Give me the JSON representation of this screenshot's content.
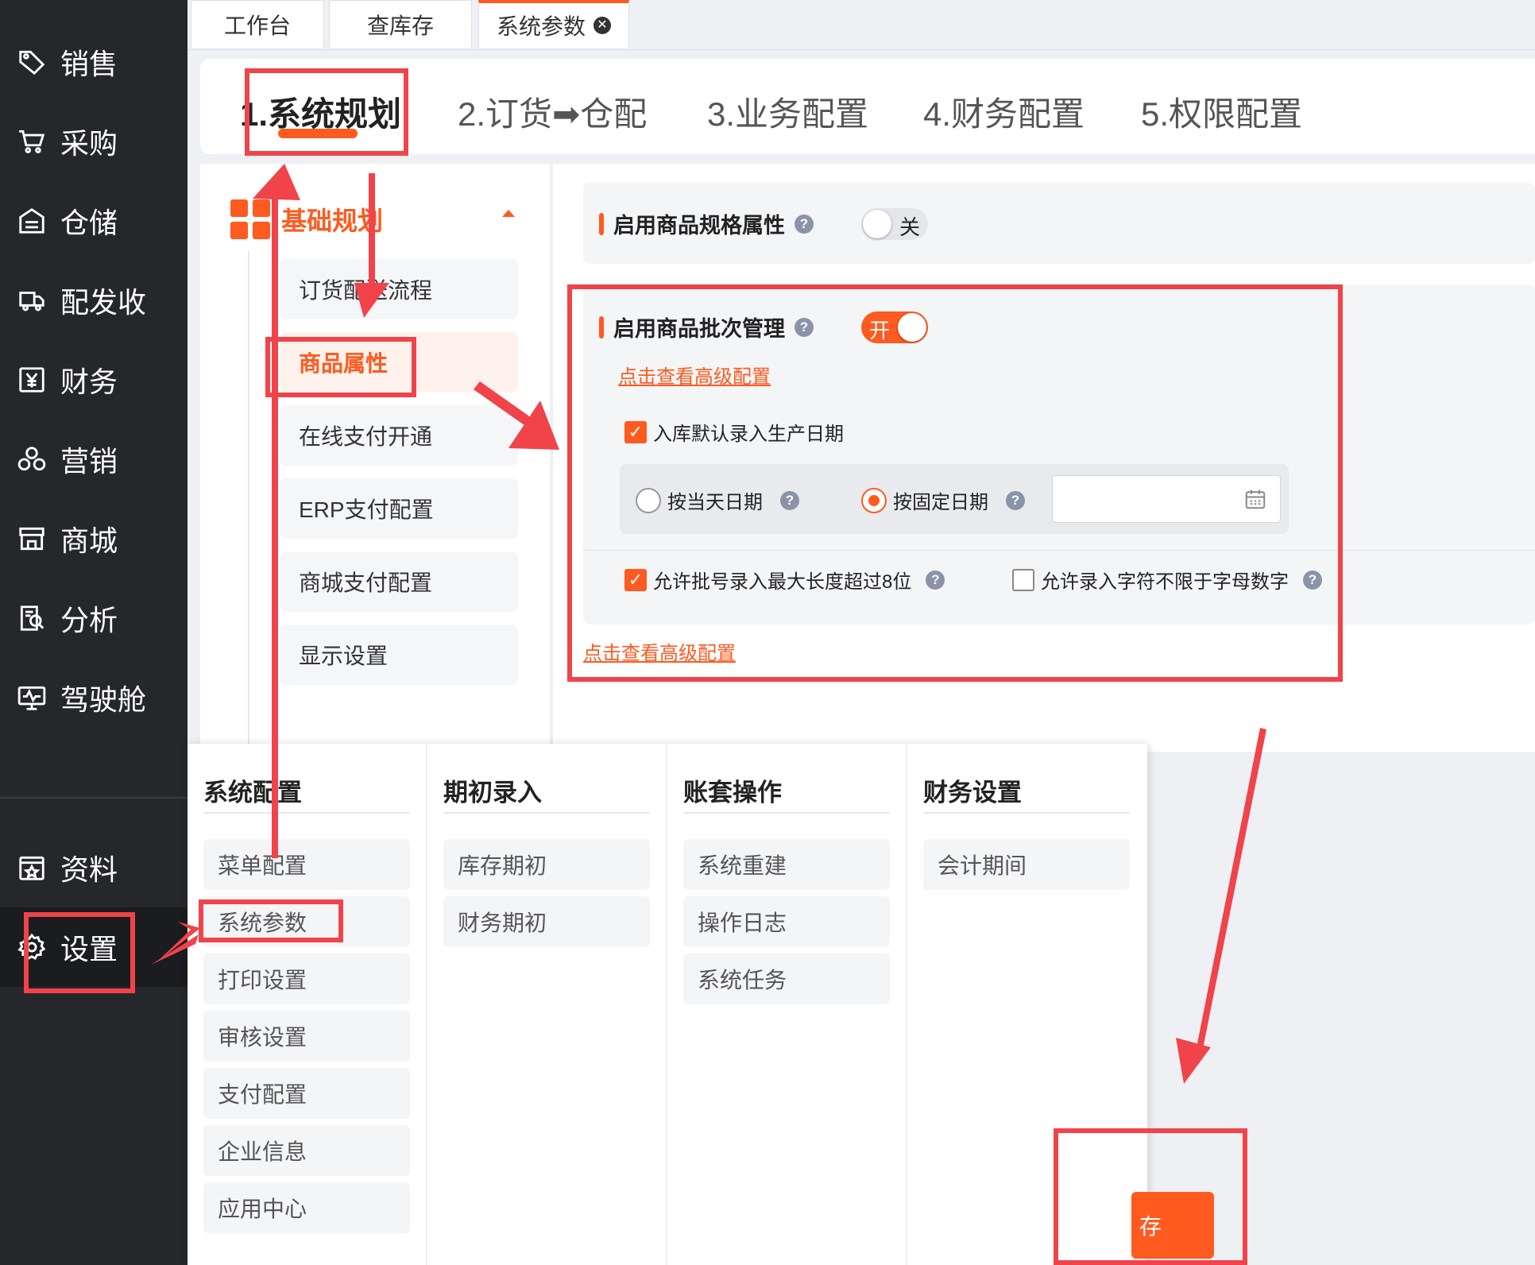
{
  "sidebar": {
    "items": [
      {
        "label": "销售",
        "icon": "tag-icon"
      },
      {
        "label": "采购",
        "icon": "cart-icon"
      },
      {
        "label": "仓储",
        "icon": "warehouse-icon"
      },
      {
        "label": "配发收",
        "icon": "delivery-truck-icon"
      },
      {
        "label": "财务",
        "icon": "yen-icon"
      },
      {
        "label": "营销",
        "icon": "marketing-icon"
      },
      {
        "label": "商城",
        "icon": "store-icon"
      },
      {
        "label": "分析",
        "icon": "analysis-icon"
      },
      {
        "label": "驾驶舱",
        "icon": "dashboard-monitor-icon"
      }
    ],
    "bottom_items": [
      {
        "label": "资料",
        "icon": "data-card-icon"
      },
      {
        "label": "设置",
        "icon": "gear-icon"
      }
    ]
  },
  "tabs": [
    {
      "label": "工作台"
    },
    {
      "label": "查库存"
    },
    {
      "label": "系统参数",
      "active": true,
      "closable": true
    }
  ],
  "steps": [
    "1.系统规划",
    "2.订货➡仓配",
    "3.业务配置",
    "4.财务配置",
    "5.权限配置"
  ],
  "submenu": {
    "group": "基础规划",
    "items": [
      "订货配送流程",
      "商品属性",
      "在线支付开通",
      "ERP支付配置",
      "商城支付配置",
      "显示设置"
    ],
    "active": "商品属性"
  },
  "main": {
    "spec_attr": {
      "title": "启用商品规格属性",
      "toggle_label": "关",
      "on": false
    },
    "batch": {
      "title": "启用商品批次管理",
      "toggle_label": "开",
      "on": true,
      "advanced_link": "点击查看高级配置",
      "default_prod_date": {
        "label": "入库默认录入生产日期",
        "checked": true
      },
      "radio_today": {
        "label": "按当天日期",
        "selected": false
      },
      "radio_fixed": {
        "label": "按固定日期",
        "selected": true
      },
      "date_value": "",
      "allow_long_batch": {
        "label": "允许批号录入最大长度超过8位",
        "checked": true
      },
      "allow_any_char": {
        "label": "允许录入字符不限于字母数字",
        "checked": false
      }
    },
    "advanced_link_2": "点击查看高级配置"
  },
  "mega_menu": {
    "columns": [
      {
        "title": "系统配置",
        "items": [
          "菜单配置",
          "系统参数",
          "打印设置",
          "审核设置",
          "支付配置",
          "企业信息",
          "应用中心"
        ]
      },
      {
        "title": "期初录入",
        "items": [
          "库存期初",
          "财务期初"
        ]
      },
      {
        "title": "账套操作",
        "items": [
          "系统重建",
          "操作日志",
          "系统任务"
        ]
      },
      {
        "title": "财务设置",
        "items": [
          "会计期间"
        ]
      }
    ]
  },
  "save_button": "存",
  "colors": {
    "accent": "#ff5a1f",
    "sidebar_bg": "#25272b",
    "annotation_red": "#f0434a"
  }
}
